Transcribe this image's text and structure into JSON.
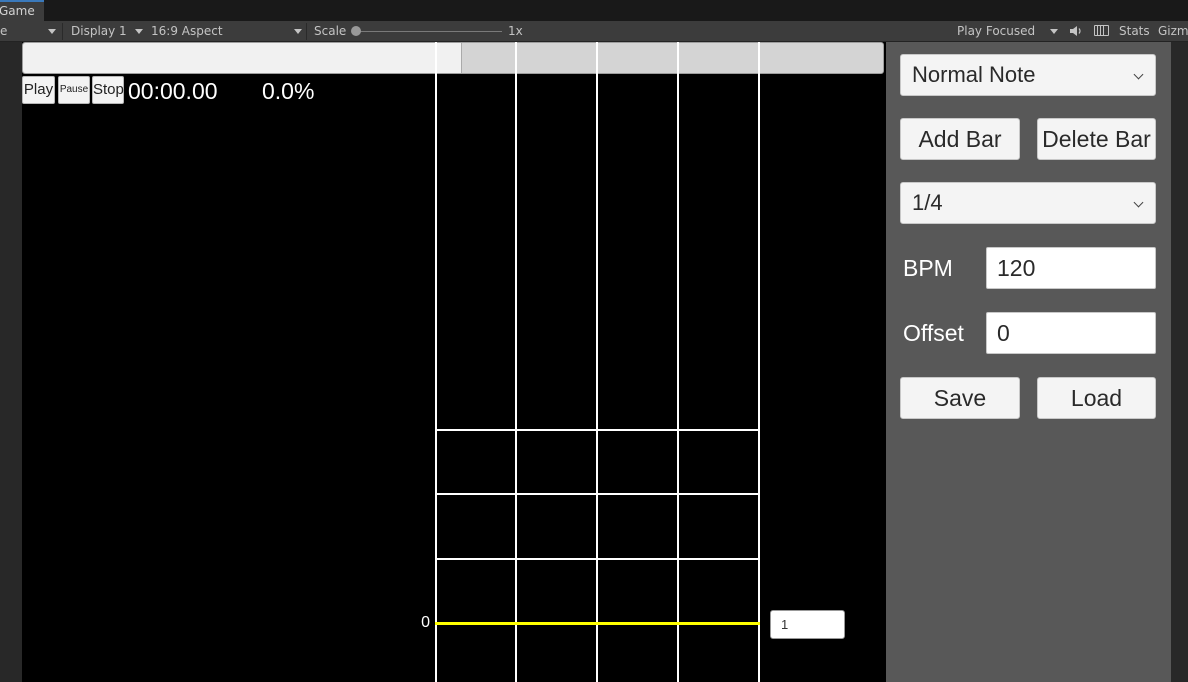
{
  "tabs": {
    "game_label": "Game"
  },
  "toolbar": {
    "view_dropdown": "e",
    "display": "Display 1",
    "aspect": "16:9 Aspect",
    "scale_label": "Scale",
    "scale_value": "1x",
    "play_mode": "Play Focused",
    "stats": "Stats",
    "gizmos": "Gizm",
    "speaker_icon": "speaker-icon",
    "keyboard_icon": "keyboard-icon"
  },
  "player": {
    "play_label": "Play",
    "pause_label": "Pause",
    "stop_label": "Stop",
    "time": "00:00.00",
    "progress_text": "0.0%",
    "scroll_fraction": 0.51
  },
  "chart": {
    "bar_number": "0",
    "bar_input": "1",
    "judge_line_color": "#ffff00"
  },
  "panel": {
    "note_type": "Normal Note",
    "add_bar": "Add Bar",
    "delete_bar": "Delete Bar",
    "division": "1/4",
    "bpm_label": "BPM",
    "bpm_value": "120",
    "offset_label": "Offset",
    "offset_value": "0",
    "save": "Save",
    "load": "Load"
  }
}
